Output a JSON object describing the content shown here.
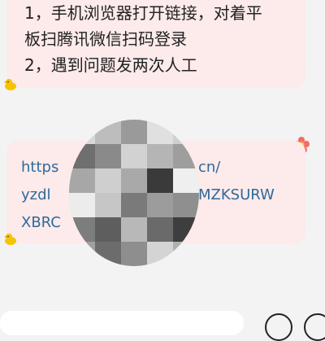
{
  "messages": [
    {
      "lines": [
        "1，手机浏览器打开链接，对着平",
        "板扫腾讯微信扫码登录",
        "2，遇到问题发两次人工"
      ]
    },
    {
      "link_lines": [
        "https",
        "cn/",
        "yzdl",
        "MZKSURW",
        "XBRC"
      ]
    }
  ],
  "icons": {
    "avatar": "duck-emoji-icon",
    "decoration": "flower-icon"
  },
  "colors": {
    "bubble": "#fdeaea",
    "link": "#2e6a9a",
    "background": "#f3f3f3"
  }
}
